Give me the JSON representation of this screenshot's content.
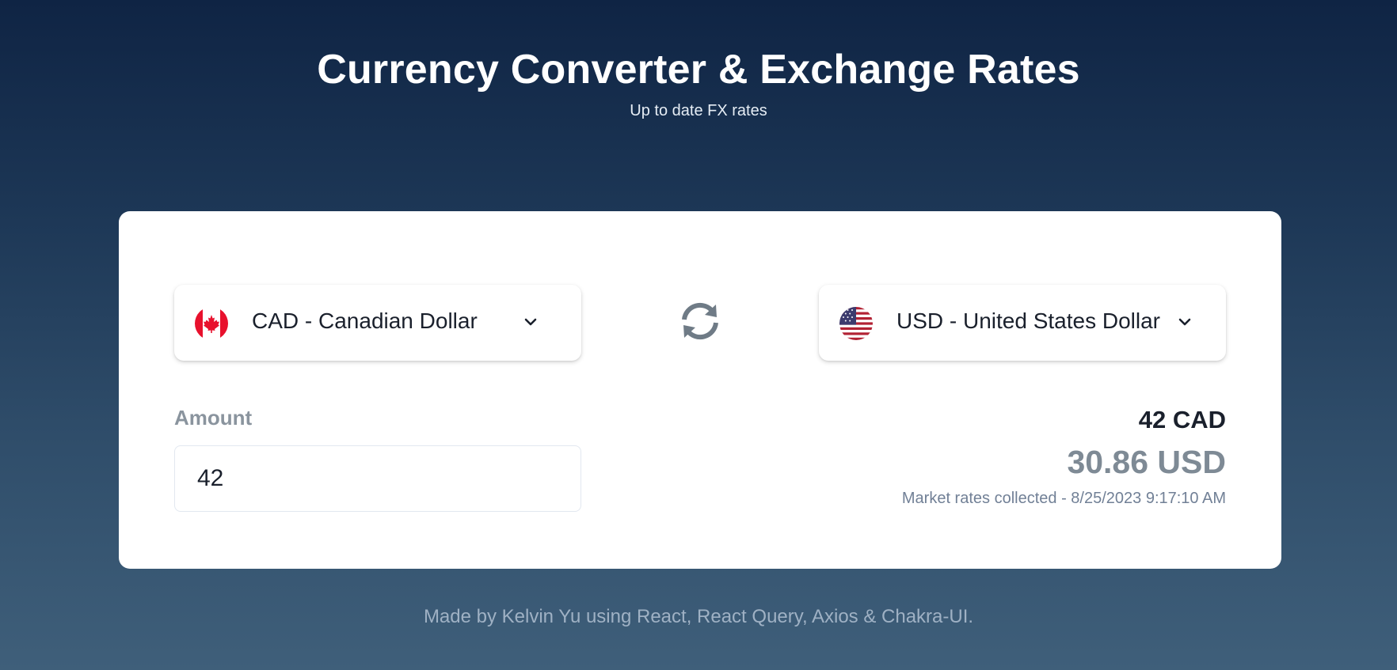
{
  "header": {
    "title": "Currency Converter & Exchange Rates",
    "subtitle": "Up to date FX rates"
  },
  "converter": {
    "from_currency": {
      "label": "CAD - Canadian Dollar",
      "flag_icon": "canada-flag-icon"
    },
    "to_currency": {
      "label": "USD - United States Dollar",
      "flag_icon": "usa-flag-icon"
    },
    "swap_icon": "swap-arrows-icon",
    "amount_label": "Amount",
    "amount_value": "42",
    "result_from": "42 CAD",
    "result_to": "30.86 USD",
    "rates_note": "Market rates collected - 8/25/2023 9:17:10 AM"
  },
  "footer": {
    "text": "Made by Kelvin Yu using React, React Query, Axios & Chakra-UI."
  },
  "colors": {
    "background_top": "#0f2444",
    "background_bottom": "#3f5f7a",
    "card": "#ffffff",
    "result_muted": "#7e8a95",
    "footer_text": "#9fb1c4"
  }
}
